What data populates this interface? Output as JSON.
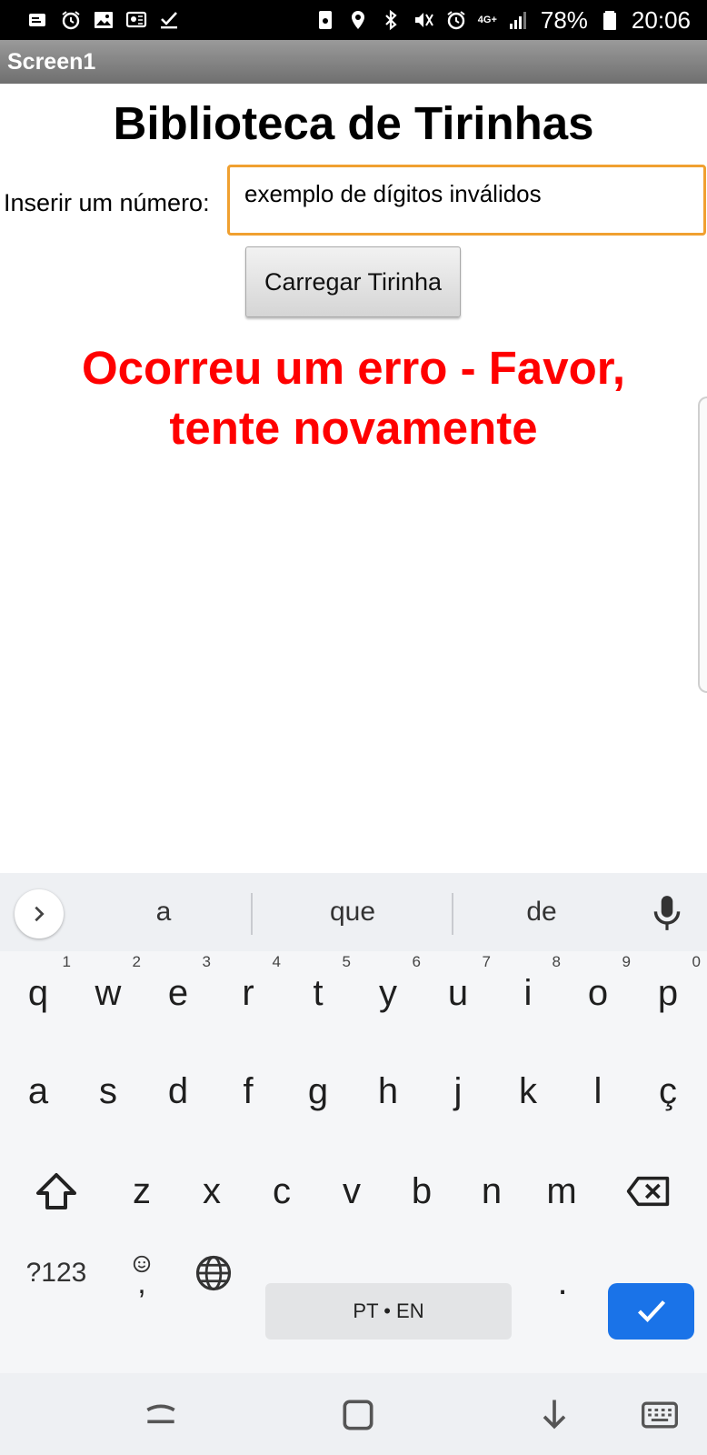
{
  "status_bar": {
    "left_icons": [
      "notification-icon",
      "alarm-icon",
      "gallery-icon",
      "cast-icon",
      "check-icon"
    ],
    "right_icons": [
      "save-icon",
      "location-icon",
      "bluetooth-icon",
      "mute-icon",
      "alarm-icon",
      "signal-icon"
    ],
    "network": "4G+",
    "battery": "78%",
    "time": "20:06"
  },
  "app": {
    "screen_name": "Screen1",
    "title": "Biblioteca de Tirinhas",
    "input_label": "Inserir um número:",
    "input_value": "exemplo de dígitos inválidos",
    "load_button": "Carregar Tirinha",
    "error_line1": "Ocorreu um erro - Favor,",
    "error_line2": "tente novamente",
    "error_color": "#ff0000",
    "input_border_color": "#f0a030"
  },
  "keyboard": {
    "suggestions": [
      "a",
      "que",
      "de"
    ],
    "row1": [
      "q",
      "w",
      "e",
      "r",
      "t",
      "y",
      "u",
      "i",
      "o",
      "p"
    ],
    "row1_hints": [
      "1",
      "2",
      "3",
      "4",
      "5",
      "6",
      "7",
      "8",
      "9",
      "0"
    ],
    "row2": [
      "a",
      "s",
      "d",
      "f",
      "g",
      "h",
      "j",
      "k",
      "l",
      "ç"
    ],
    "row3": [
      "z",
      "x",
      "c",
      "v",
      "b",
      "n",
      "m"
    ],
    "symbols_key": "?123",
    "comma_key": ",",
    "period_key": ".",
    "space_label": "PT • EN",
    "enter_color": "#1a73e8"
  }
}
